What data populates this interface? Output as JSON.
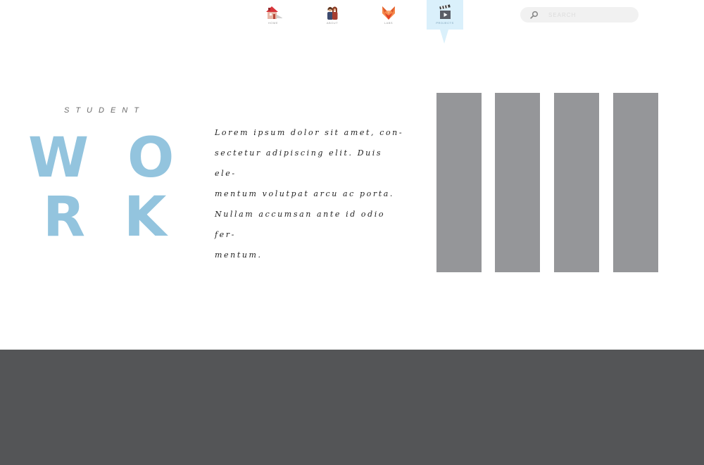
{
  "nav": {
    "items": [
      {
        "label": "HOME",
        "icon": "house-icon",
        "active": false
      },
      {
        "label": "ABOUT",
        "icon": "people-icon",
        "active": false
      },
      {
        "label": "LABS",
        "icon": "fox-icon",
        "active": false
      },
      {
        "label": "PROJECTS",
        "icon": "clapperboard-icon",
        "active": true
      }
    ],
    "active_color": "#daf0fb"
  },
  "search": {
    "placeholder": "SEARCH",
    "value": "",
    "icon": "search-icon"
  },
  "hero": {
    "kicker": "STUDENT",
    "letters": [
      "W",
      "O",
      "R",
      "K"
    ],
    "accent_color": "#93c4de"
  },
  "content": {
    "lines": [
      "Lorem ipsum dolor sit amet, con-",
      "sectetur adipiscing elit. Duis ele-",
      "mentum volutpat arcu ac porta.",
      "Nullam accumsan ante id odio fer-",
      "mentum."
    ]
  },
  "panels": {
    "color": "#959699"
  },
  "footer": {
    "color": "#545557"
  }
}
